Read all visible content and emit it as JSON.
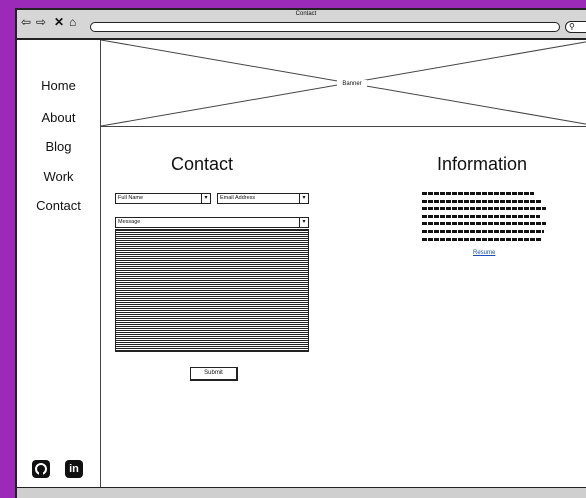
{
  "window": {
    "title": "Contact"
  },
  "browser": {
    "back_icon": "back-arrow-icon",
    "forward_icon": "forward-arrow-icon",
    "close_icon": "close-icon",
    "home_icon": "home-icon",
    "search_icon": "search-icon"
  },
  "sidebar": {
    "items": [
      {
        "label": "Home"
      },
      {
        "label": "About"
      },
      {
        "label": "Blog"
      },
      {
        "label": "Work"
      },
      {
        "label": "Contact"
      }
    ],
    "social": [
      {
        "icon": "github-icon"
      },
      {
        "icon": "linkedin-icon",
        "label": "in"
      }
    ]
  },
  "banner": {
    "label": "Banner"
  },
  "contact": {
    "title": "Contact",
    "full_name": "Full Name",
    "email": "Email Address",
    "message": "Message",
    "submit": "Submit"
  },
  "information": {
    "title": "Information",
    "resume_link": "Resume"
  },
  "colors": {
    "background": "#9b2ab8",
    "link": "#1a4fb5"
  }
}
